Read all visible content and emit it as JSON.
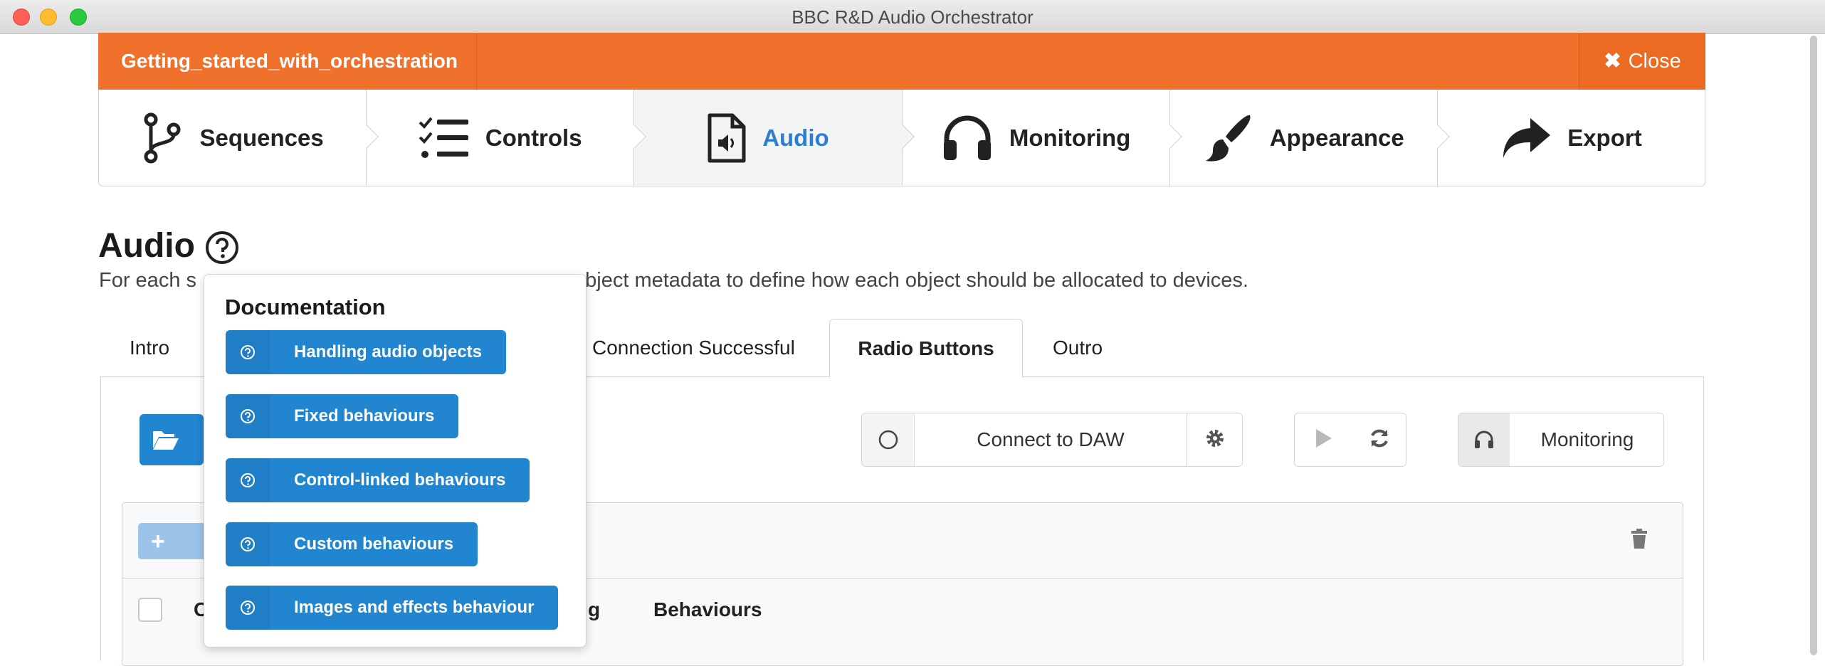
{
  "window": {
    "title": "BBC R&D Audio Orchestrator"
  },
  "header": {
    "project_name": "Getting_started_with_orchestration",
    "close_label": "Close"
  },
  "steps": [
    {
      "label": "Sequences",
      "icon": "branch-icon"
    },
    {
      "label": "Controls",
      "icon": "tasks-icon"
    },
    {
      "label": "Audio",
      "icon": "file-audio-icon",
      "active": true
    },
    {
      "label": "Monitoring",
      "icon": "headphones-icon"
    },
    {
      "label": "Appearance",
      "icon": "paint-brush-icon"
    },
    {
      "label": "Export",
      "icon": "share-icon"
    }
  ],
  "page": {
    "title": "Audio",
    "intro_left": "For each s",
    "intro_right": "object metadata to define how each object should be allocated to devices."
  },
  "tabs": [
    {
      "label": "Intro"
    },
    {
      "label": "Connection Successful"
    },
    {
      "label": "Radio Buttons",
      "active": true
    },
    {
      "label": "Outro"
    }
  ],
  "toolbar": {
    "connect_daw_label": "Connect to DAW",
    "monitoring_label": "Monitoring"
  },
  "table": {
    "columns": [
      "C",
      "g",
      "Behaviours"
    ]
  },
  "documentation": {
    "title": "Documentation",
    "links": [
      {
        "label": "Handling audio objects"
      },
      {
        "label": "Fixed behaviours"
      },
      {
        "label": "Control-linked behaviours"
      },
      {
        "label": "Custom behaviours"
      },
      {
        "label": "Images and effects behaviour"
      }
    ]
  },
  "colors": {
    "accent": "#f0712c",
    "primary": "#2185d0",
    "active_text": "#2e7dd1"
  }
}
